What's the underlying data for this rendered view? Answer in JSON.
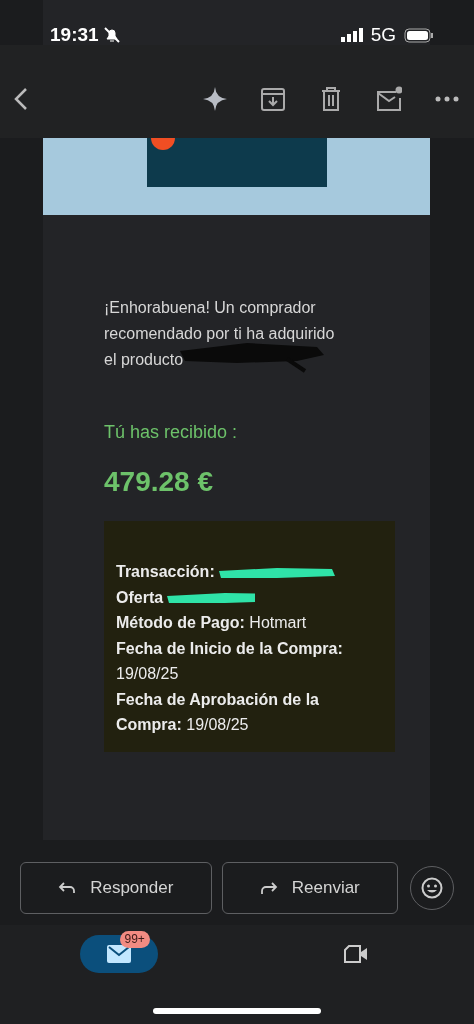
{
  "status_bar": {
    "time": "19:31",
    "network": "5G"
  },
  "toolbar": {
    "actions": [
      {
        "kind": "sparkle"
      },
      {
        "kind": "archive"
      },
      {
        "kind": "delete"
      },
      {
        "kind": "unread"
      },
      {
        "kind": "more"
      }
    ]
  },
  "email": {
    "intro": "¡Enhorabuena! Un comprador recomendado por ti ha adquirido el producto",
    "received_label": "Tú has recibido :",
    "amount": "479.28 €",
    "details": [
      {
        "text": "**Transacción:**",
        "redacted": true
      },
      {
        "text": "**Oferta**",
        "redacted": true
      },
      {
        "text": "**Método de Pago:** Hotmart",
        "redacted": false
      },
      {
        "text": "**Fecha de Inicio de la Compra:** 19/08/25",
        "redacted": false
      },
      {
        "text": "**Fecha de Aprobación de la Compra:** 19/08/25",
        "redacted": false
      }
    ]
  },
  "actions": [
    {
      "kind": "reply",
      "label": "Responder"
    },
    {
      "kind": "forward",
      "label": "Reenviar"
    }
  ],
  "bottom_nav": [
    {
      "kind": "mail",
      "selected": true,
      "badge": "99+"
    },
    {
      "kind": "meet",
      "selected": false
    }
  ]
}
